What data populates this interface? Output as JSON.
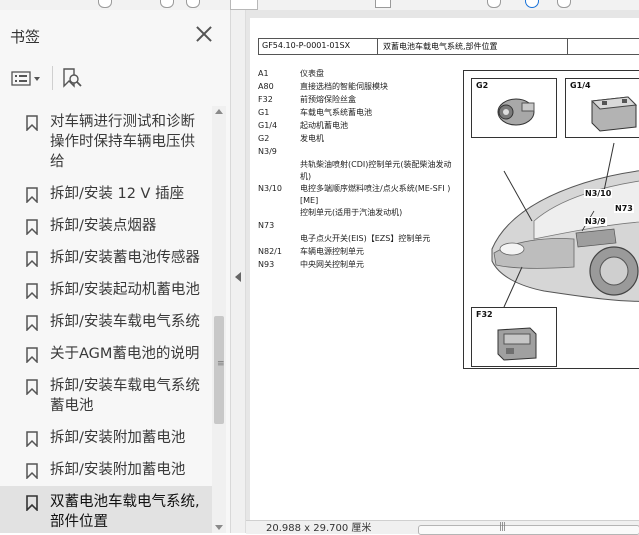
{
  "sidebar": {
    "title": "书签",
    "items": [
      {
        "label": "对车辆进行测试和诊断操作时保持车辆电压供给"
      },
      {
        "label": "拆卸/安装 12 V 插座"
      },
      {
        "label": "拆卸/安装点烟器"
      },
      {
        "label": "拆卸/安装蓄电池传感器"
      },
      {
        "label": "拆卸/安装起动机蓄电池"
      },
      {
        "label": "拆卸/安装车载电气系统"
      },
      {
        "label": "关于AGM蓄电池的说明"
      },
      {
        "label": "拆卸/安装车载电气系统蓄电池"
      },
      {
        "label": "拆卸/安装附加蓄电池"
      },
      {
        "label": "拆卸/安装附加蓄电池"
      },
      {
        "label": "双蓄电池车载电气系统,部件位置"
      }
    ],
    "selected_index": 10,
    "scroll_position": 0.55
  },
  "document": {
    "doc_code": "GF54.10-P-0001-01SX",
    "doc_title": "双蓄电池车载电气系统,部件位置",
    "legend": [
      {
        "code": "A1",
        "desc": "仪表盘"
      },
      {
        "code": "A80",
        "desc": "直接选档的智能伺服模块"
      },
      {
        "code": "F32",
        "desc": "前预熔保险丝盒"
      },
      {
        "code": "G1",
        "desc": "车载电气系统蓄电池"
      },
      {
        "code": "G1/4",
        "desc": "起动机蓄电池"
      },
      {
        "code": "G2",
        "desc": "发电机"
      },
      {
        "code": "N3/9",
        "desc": ""
      },
      {
        "code": "",
        "desc": "共轨柴油喷射(CDI)控制单元(装配柴油发动机)"
      },
      {
        "code": "N3/10",
        "desc": "电控多端顺序燃料喷注/点火系统(ME-SFI )[ME]"
      },
      {
        "code": "",
        "desc": "控制单元(适用于汽油发动机)"
      },
      {
        "code": "N73",
        "desc": ""
      },
      {
        "code": "",
        "desc": "电子点火开关(EIS)【EZS】控制单元"
      },
      {
        "code": "N82/1",
        "desc": "车辆电源控制单元"
      },
      {
        "code": "N93",
        "desc": "中央网关控制单元"
      }
    ],
    "figure_labels": {
      "g2": "G2",
      "g14": "G1/4",
      "f32": "F32",
      "n310": "N3/10",
      "n73": "N73",
      "n39": "N3/9"
    }
  },
  "statusbar": {
    "page_size": "20.988 x 29.700 厘米"
  },
  "colors": {
    "panel_bg": "#f7f7f7",
    "selected_bg": "#e2e2e2",
    "doc_bg": "#e6e6e6",
    "accent": "#1a73d9"
  }
}
